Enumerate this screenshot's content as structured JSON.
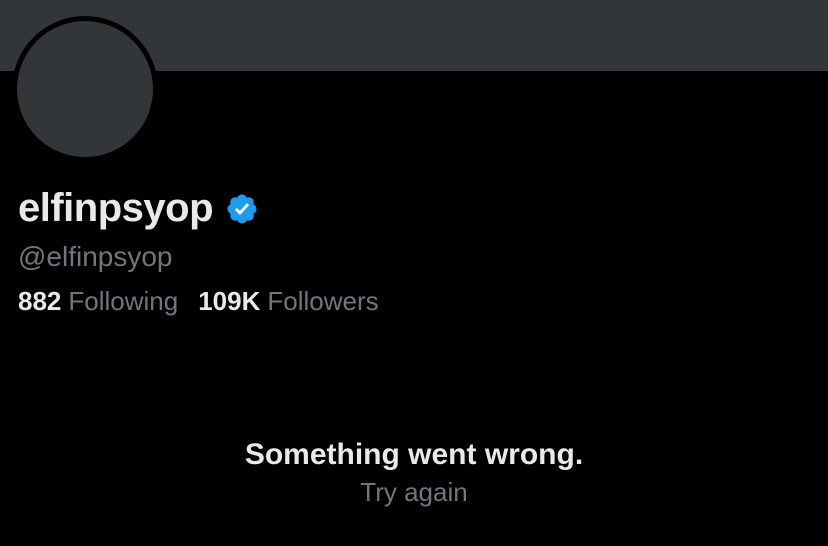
{
  "profile": {
    "display_name": "elfinpsyop",
    "handle": "@elfinpsyop",
    "verified_icon": "verified-badge-icon",
    "stats": {
      "following_count": "882",
      "following_label": "Following",
      "followers_count": "109K",
      "followers_label": "Followers"
    }
  },
  "error": {
    "message": "Something went wrong.",
    "retry_label": "Try again"
  },
  "colors": {
    "background": "#000000",
    "banner": "#333639",
    "avatar_placeholder": "#333639",
    "primary_text": "#e7e9ea",
    "secondary_text": "#71767b",
    "verified_blue": "#1d9bf0"
  }
}
